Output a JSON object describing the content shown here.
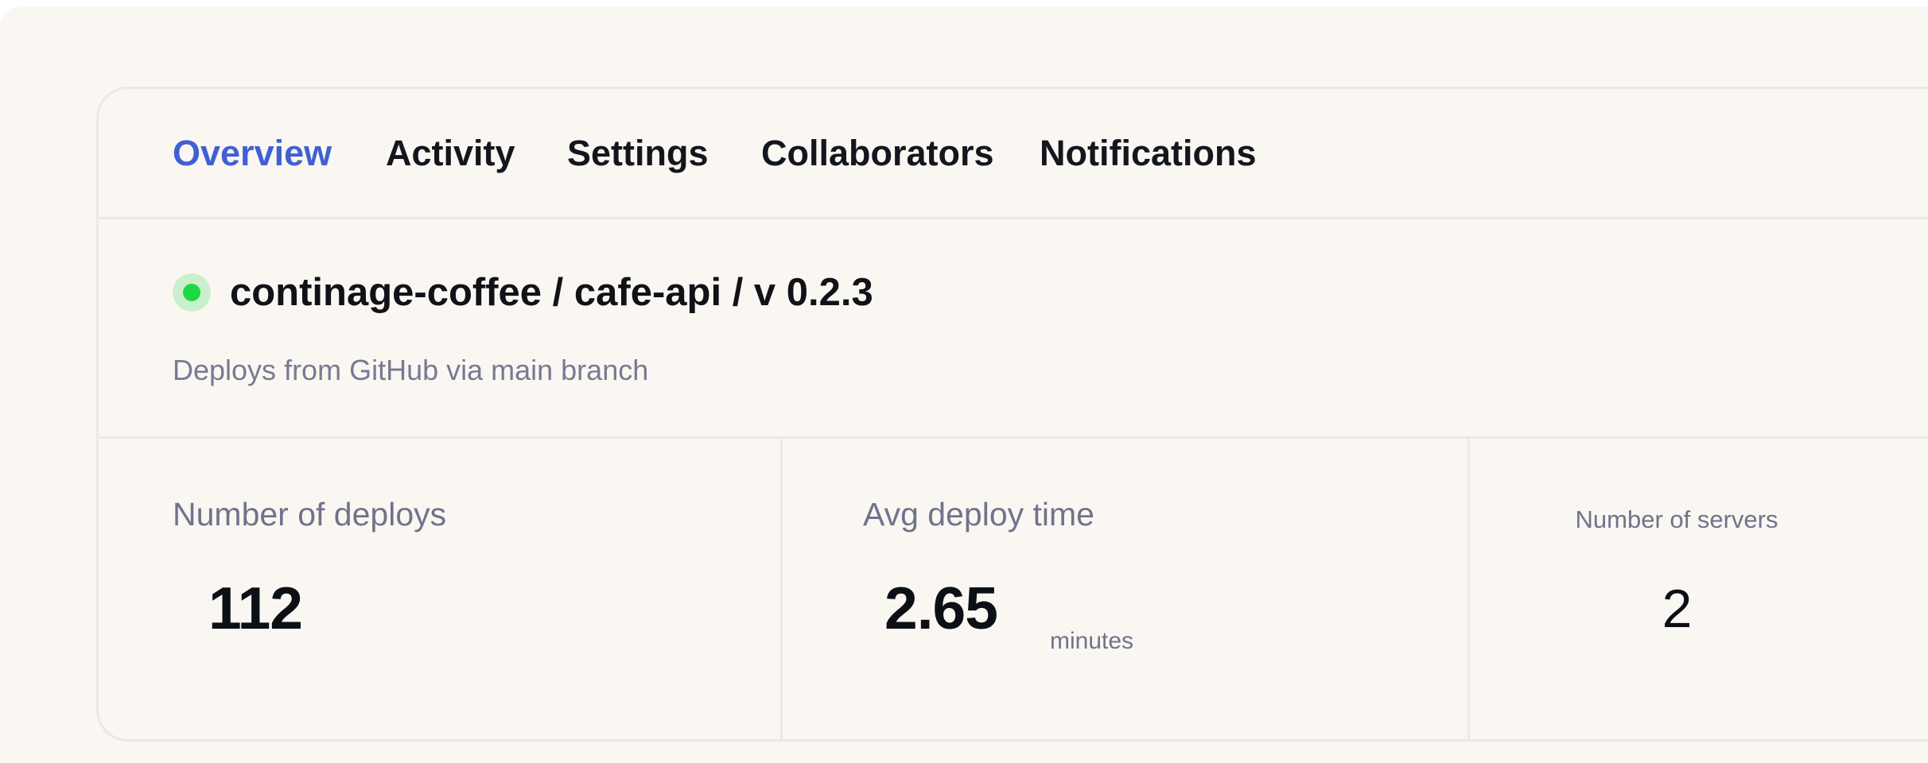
{
  "tabs": [
    {
      "label": "Overview",
      "active": true
    },
    {
      "label": "Activity",
      "active": false
    },
    {
      "label": "Settings",
      "active": false
    },
    {
      "label": "Collaborators",
      "active": false
    },
    {
      "label": "Notifications",
      "active": false
    }
  ],
  "repo": {
    "status": "online",
    "status_color": "#1ed843",
    "path": "continage-coffee / cafe-api / v 0.2.3",
    "subtitle": "Deploys from GitHub via main branch"
  },
  "stats": [
    {
      "label": "Number of deploys",
      "value": "112",
      "unit": ""
    },
    {
      "label": "Avg deploy time",
      "value": "2.65",
      "unit": "minutes"
    },
    {
      "label": "Number of servers",
      "value": "2",
      "unit": ""
    }
  ],
  "colors": {
    "accent": "#4060d4",
    "background": "#faf7f2",
    "border": "#ece8e4",
    "muted_text": "#70738b"
  }
}
